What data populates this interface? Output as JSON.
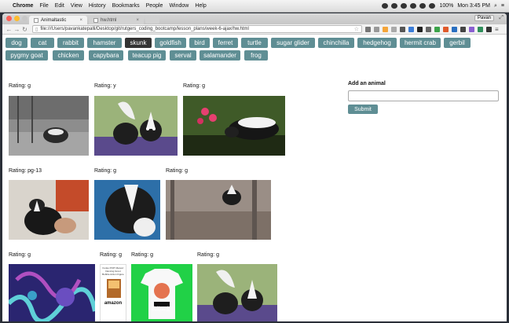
{
  "menubar": {
    "app": "Chrome",
    "items": [
      "File",
      "Edit",
      "View",
      "History",
      "Bookmarks",
      "People",
      "Window",
      "Help"
    ],
    "battery": "100%",
    "clock": "Mon 3:45 PM"
  },
  "browser": {
    "tabs": [
      {
        "title": "Animaltastic"
      },
      {
        "title": "hw.html"
      }
    ],
    "profile": "Pavan",
    "url": "file:///Users/pavankatepalli/Desktop/git/rutgers_coding_bootcamp/lesson_plans/week-6-ajax/hw.html"
  },
  "animals": {
    "buttons": [
      "dog",
      "cat",
      "rabbit",
      "hamster",
      "skunk",
      "goldfish",
      "bird",
      "ferret",
      "turtle",
      "sugar glider",
      "chinchilla",
      "hedgehog",
      "hermit crab",
      "gerbil",
      "pygmy goat",
      "chicken",
      "capybara",
      "teacup pig",
      "serval",
      "salamander",
      "frog"
    ],
    "active": "skunk"
  },
  "gifs": [
    {
      "rating": "Rating: g",
      "icon": "skunk-photo"
    },
    {
      "rating": "Rating: y",
      "icon": "skunk-cartoon"
    },
    {
      "rating": "Rating: g",
      "icon": "skunk-flowers"
    },
    {
      "rating": "Rating: pg-13",
      "icon": "skunk-held"
    },
    {
      "rating": "Rating: g",
      "icon": "skunk-closeup"
    },
    {
      "rating": "Rating: g",
      "icon": "skunk-forest"
    },
    {
      "rating": "Rating: g",
      "icon": "octopus-art"
    },
    {
      "rating": "Rating: g",
      "icon": "amazon-product"
    },
    {
      "rating": "Rating: g",
      "icon": "green-tshirt"
    },
    {
      "rating": "Rating: g",
      "icon": "skunk-cartoon-2"
    }
  ],
  "product": {
    "caption": "Funko POP! Marvel: Dancing Groot Bobble Action Figure",
    "brand": "amazon"
  },
  "shirt": {
    "caption": "我的公主"
  },
  "form": {
    "label": "Add an animal",
    "input_value": "",
    "submit": "Submit"
  }
}
